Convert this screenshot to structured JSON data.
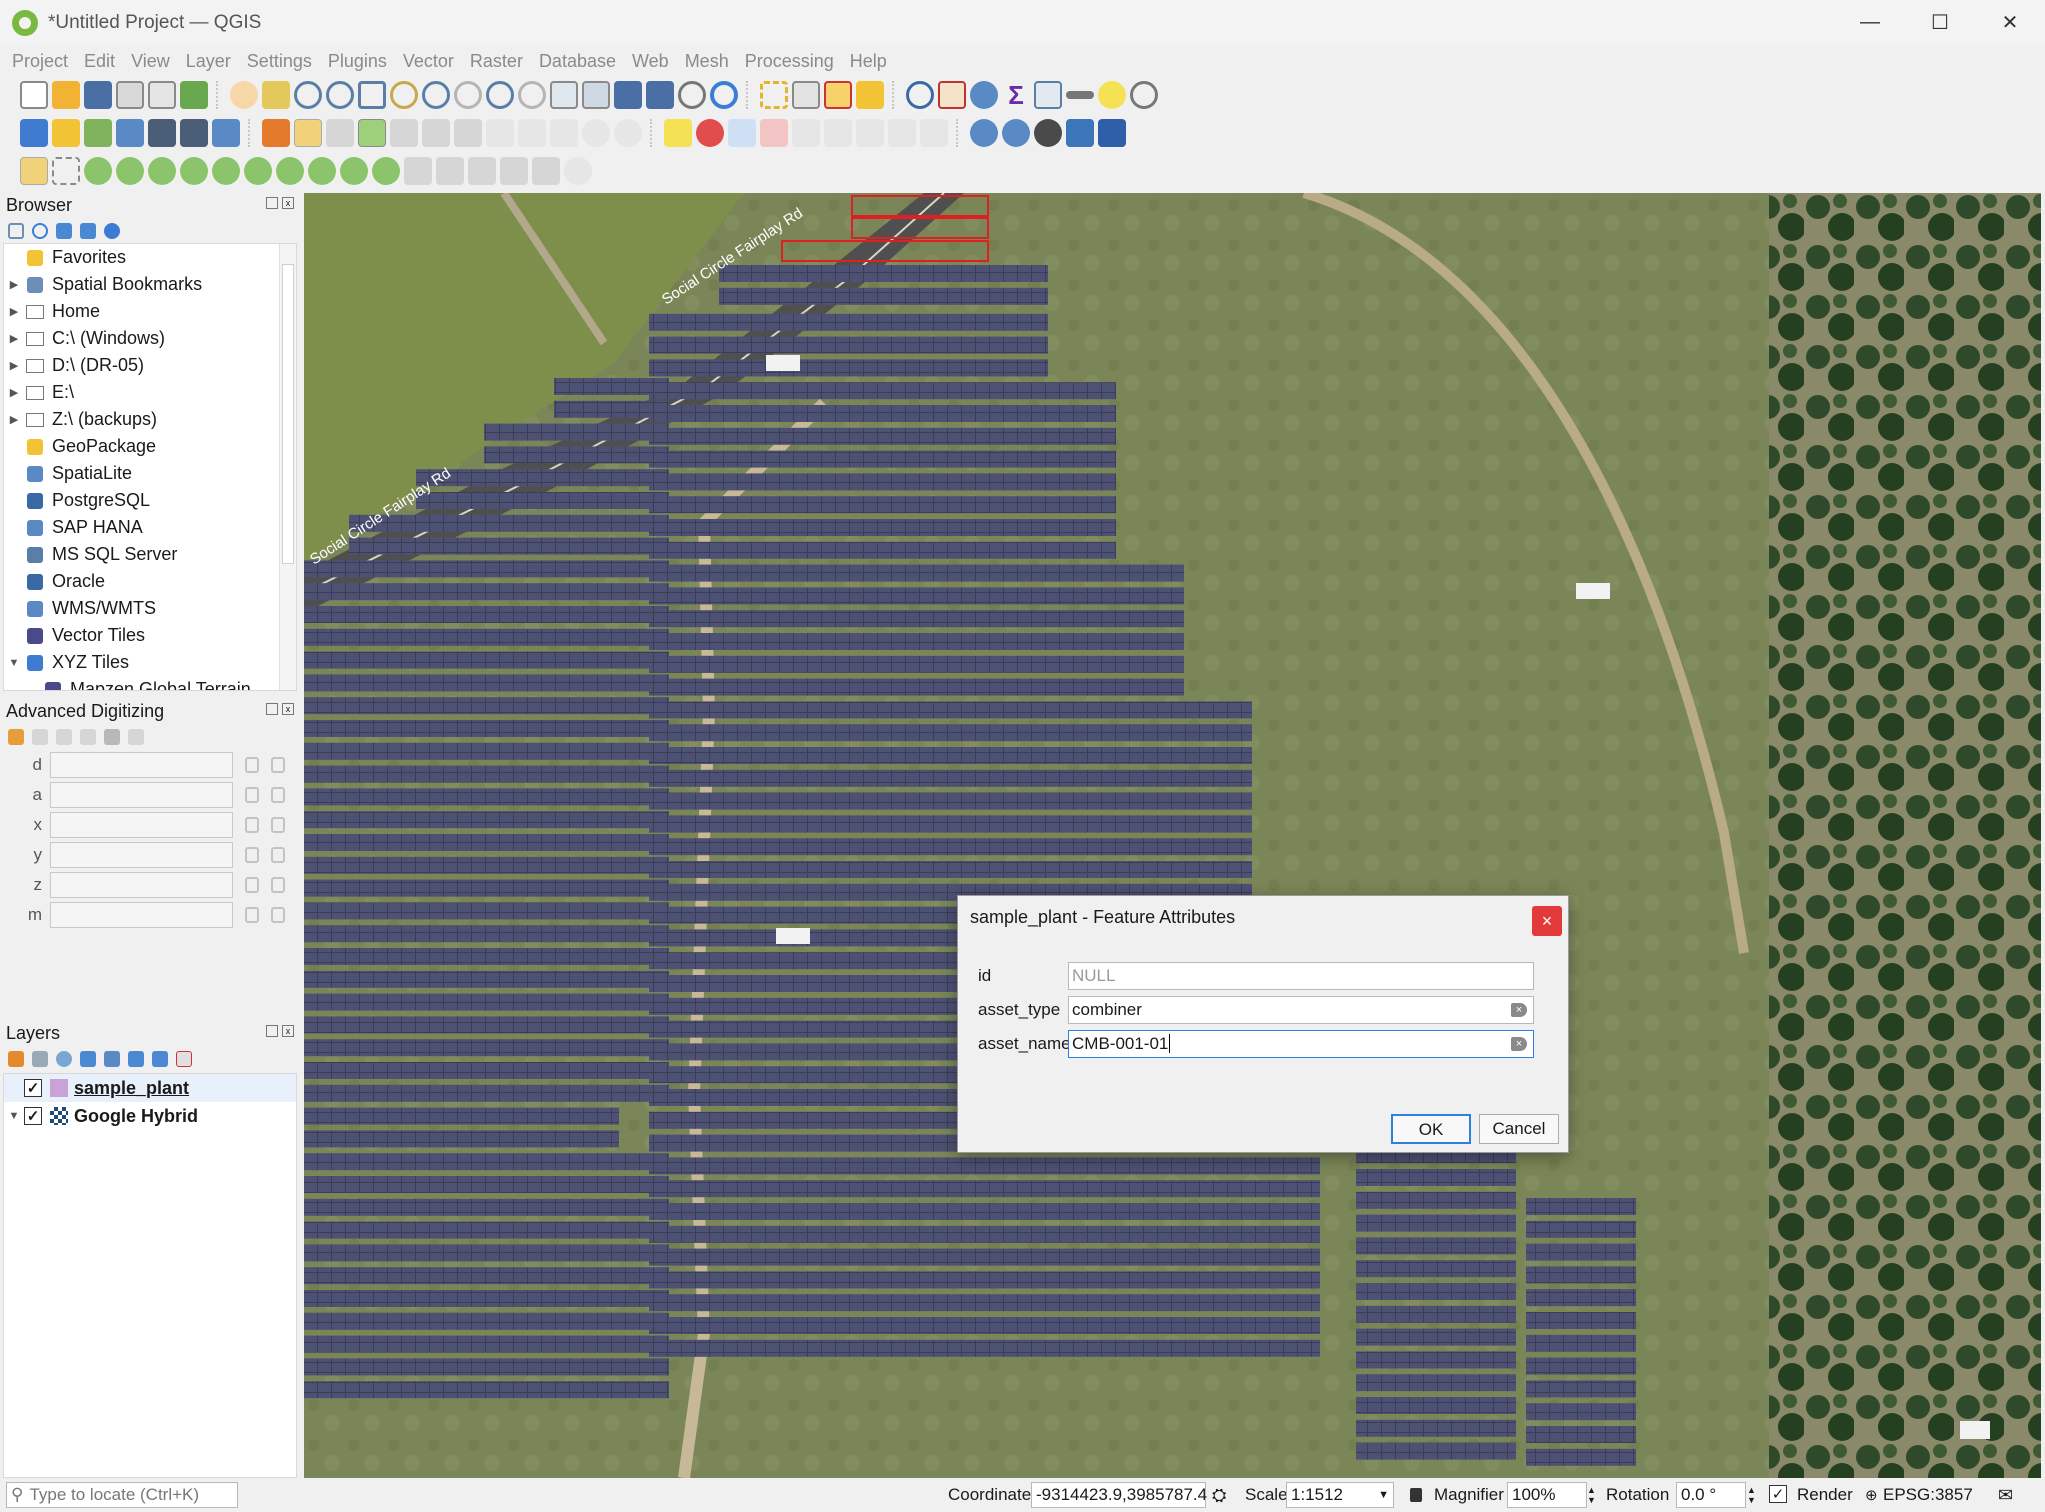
{
  "window": {
    "title": "*Untitled Project — QGIS",
    "minimize": "—",
    "maximize": "☐",
    "close": "✕"
  },
  "menu": [
    "Project",
    "Edit",
    "View",
    "Layer",
    "Settings",
    "Plugins",
    "Vector",
    "Raster",
    "Database",
    "Web",
    "Mesh",
    "Processing",
    "Help"
  ],
  "browser": {
    "title": "Browser",
    "items": [
      {
        "label": "Favorites",
        "icon": "star-icon",
        "expander": ""
      },
      {
        "label": "Spatial Bookmarks",
        "icon": "bookmark-icon",
        "expander": "▶"
      },
      {
        "label": "Home",
        "icon": "home-folder-icon",
        "expander": "▶"
      },
      {
        "label": "C:\\ (Windows)",
        "icon": "folder-icon",
        "expander": "▶"
      },
      {
        "label": "D:\\ (DR-05)",
        "icon": "folder-icon",
        "expander": "▶"
      },
      {
        "label": "E:\\",
        "icon": "folder-icon",
        "expander": "▶"
      },
      {
        "label": "Z:\\ (backups)",
        "icon": "folder-icon",
        "expander": "▶"
      },
      {
        "label": "GeoPackage",
        "icon": "geopackage-icon",
        "expander": ""
      },
      {
        "label": "SpatiaLite",
        "icon": "spatialite-icon",
        "expander": ""
      },
      {
        "label": "PostgreSQL",
        "icon": "postgresql-icon",
        "expander": ""
      },
      {
        "label": "SAP HANA",
        "icon": "sap-hana-icon",
        "expander": ""
      },
      {
        "label": "MS SQL Server",
        "icon": "mssql-icon",
        "expander": ""
      },
      {
        "label": "Oracle",
        "icon": "oracle-icon",
        "expander": ""
      },
      {
        "label": "WMS/WMTS",
        "icon": "globe-icon",
        "expander": ""
      },
      {
        "label": "Vector Tiles",
        "icon": "grid-icon",
        "expander": ""
      },
      {
        "label": "XYZ Tiles",
        "icon": "xyz-tiles-icon",
        "expander": "▼"
      },
      {
        "label": "Mapzen Global Terrain",
        "icon": "grid-icon",
        "expander": ""
      }
    ]
  },
  "digitizing": {
    "title": "Advanced Digitizing",
    "fields": [
      "d",
      "a",
      "x",
      "y",
      "z",
      "m"
    ]
  },
  "layers": {
    "title": "Layers",
    "items": [
      {
        "name": "sample_plant",
        "checked": "✓",
        "underline": true
      },
      {
        "name": "Google Hybrid",
        "checked": "✓",
        "underline": false
      }
    ]
  },
  "map": {
    "road_label_1": "Social Circle Fairplay Rd",
    "road_label_2": "Social Circle Fairplay Rd"
  },
  "dialog": {
    "title": "sample_plant - Feature Attributes",
    "close": "×",
    "fields": [
      {
        "label": "id",
        "value": "NULL"
      },
      {
        "label": "asset_type",
        "value": "combiner"
      },
      {
        "label": "asset_name",
        "value": "CMB-001-01"
      }
    ],
    "ok": "OK",
    "cancel": "Cancel"
  },
  "status": {
    "locate_placeholder": "Type to locate (Ctrl+K)",
    "coordinate_label": "Coordinate",
    "coordinate_value": "-9314423.9,3985787.4",
    "scale_label": "Scale",
    "scale_value": "1:1512",
    "magnifier_label": "Magnifier",
    "magnifier_value": "100%",
    "rotation_label": "Rotation",
    "rotation_value": "0.0 °",
    "render_label": "Render",
    "render_checked": "✓",
    "crs": "EPSG:3857"
  }
}
